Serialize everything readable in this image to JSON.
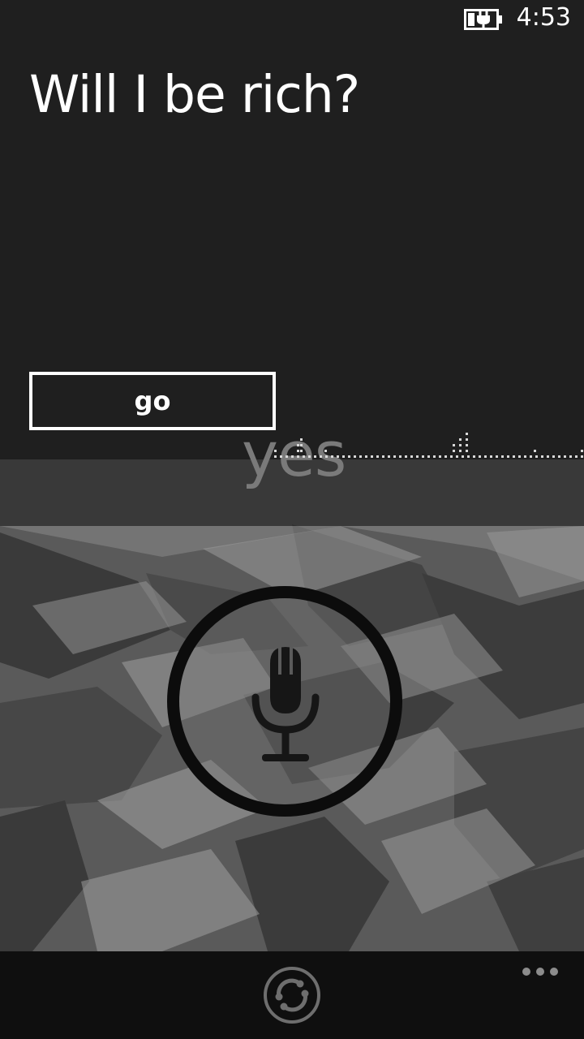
{
  "status_bar": {
    "time": "4:53",
    "battery_icon": "battery-charging-icon"
  },
  "question": {
    "text": "Will I be rich?"
  },
  "go_button": {
    "label": "go"
  },
  "answer": {
    "text": "yes"
  },
  "mic_button": {
    "icon": "microphone-icon"
  },
  "app_bar": {
    "refresh_icon": "refresh-icon",
    "more_icon": "ellipsis-icon"
  },
  "colors": {
    "background": "#1f1f1f",
    "foreground": "#ffffff",
    "app_bar": "#0f0f0f",
    "answer_text": "#7a7a7a"
  }
}
